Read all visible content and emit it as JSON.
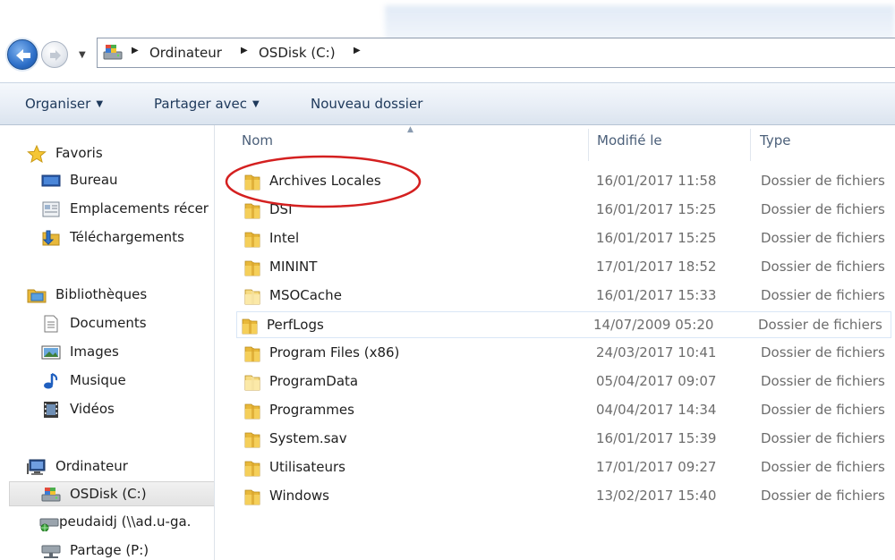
{
  "navigation": {
    "back_icon": "back-arrow-icon",
    "forward_icon": "forward-arrow-icon",
    "recent_icon": "chevron-down-icon"
  },
  "address": {
    "crumbs": [
      "Ordinateur",
      "OSDisk (C:)"
    ],
    "separator": "▶"
  },
  "toolbar": {
    "organize_label": "Organiser",
    "share_label": "Partager avec",
    "new_folder_label": "Nouveau dossier",
    "dropdown_arrow": "▼"
  },
  "sidebar": {
    "favorites": {
      "label": "Favoris",
      "items": [
        {
          "label": "Bureau",
          "icon": "desktop-icon"
        },
        {
          "label": "Emplacements récer",
          "icon": "recent-places-icon"
        },
        {
          "label": "Téléchargements",
          "icon": "downloads-icon"
        }
      ]
    },
    "libraries": {
      "label": "Bibliothèques",
      "items": [
        {
          "label": "Documents",
          "icon": "documents-icon"
        },
        {
          "label": "Images",
          "icon": "pictures-icon"
        },
        {
          "label": "Musique",
          "icon": "music-icon"
        },
        {
          "label": "Vidéos",
          "icon": "videos-icon"
        }
      ]
    },
    "computer": {
      "label": "Ordinateur",
      "items": [
        {
          "label": "OSDisk (C:)",
          "icon": "drive-icon",
          "selected": true
        },
        {
          "label": "peudaidj (\\\\ad.u-ga.",
          "icon": "network-drive-icon"
        },
        {
          "label": "Partage (P:)",
          "icon": "network-drive-icon"
        }
      ]
    }
  },
  "file_list": {
    "columns": [
      "Nom",
      "Modifié le",
      "Type"
    ],
    "sort_indicator": "▲",
    "rows": [
      {
        "name": "Archives Locales",
        "modified": "16/01/2017 11:58",
        "type": "Dossier de fichiers"
      },
      {
        "name": "DSI",
        "modified": "16/01/2017 15:25",
        "type": "Dossier de fichiers"
      },
      {
        "name": "Intel",
        "modified": "16/01/2017 15:25",
        "type": "Dossier de fichiers"
      },
      {
        "name": "MININT",
        "modified": "17/01/2017 18:52",
        "type": "Dossier de fichiers"
      },
      {
        "name": "MSOCache",
        "modified": "16/01/2017 15:33",
        "type": "Dossier de fichiers"
      },
      {
        "name": "PerfLogs",
        "modified": "14/07/2009 05:20",
        "type": "Dossier de fichiers"
      },
      {
        "name": "Program Files (x86)",
        "modified": "24/03/2017 10:41",
        "type": "Dossier de fichiers"
      },
      {
        "name": "ProgramData",
        "modified": "05/04/2017 09:07",
        "type": "Dossier de fichiers"
      },
      {
        "name": "Programmes",
        "modified": "04/04/2017 14:34",
        "type": "Dossier de fichiers"
      },
      {
        "name": "System.sav",
        "modified": "16/01/2017 15:39",
        "type": "Dossier de fichiers"
      },
      {
        "name": "Utilisateurs",
        "modified": "17/01/2017 09:27",
        "type": "Dossier de fichiers"
      },
      {
        "name": "Windows",
        "modified": "13/02/2017 15:40",
        "type": "Dossier de fichiers"
      }
    ],
    "hovered_row": "PerfLogs",
    "annotation_color": "#d42020"
  },
  "colors": {
    "folder": "#e8b83a",
    "folder_light": "#f7dc84",
    "toolbar_text": "#1e395b",
    "muted_text": "#6d6d6d"
  }
}
